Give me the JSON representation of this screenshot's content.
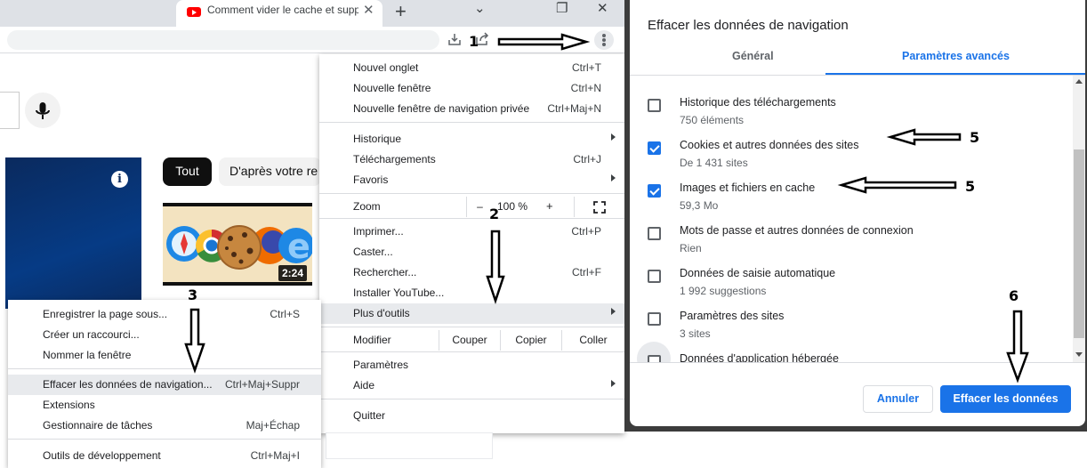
{
  "browser": {
    "tab_title": "Comment vider le cache et supp",
    "tab_close": "✕",
    "new_tab": "+",
    "window_controls": {
      "dropdown": "⌄",
      "restore": "❐",
      "close": "✕"
    }
  },
  "page": {
    "chips": {
      "all": "Tout",
      "recommended": "D'après votre re"
    },
    "info": "i",
    "thumbnail_duration": "2:24"
  },
  "main_menu": {
    "new_tab": {
      "label": "Nouvel onglet",
      "shortcut": "Ctrl+T"
    },
    "new_window": {
      "label": "Nouvelle fenêtre",
      "shortcut": "Ctrl+N"
    },
    "new_private": {
      "label": "Nouvelle fenêtre de navigation privée",
      "shortcut": "Ctrl+Maj+N"
    },
    "history": {
      "label": "Historique"
    },
    "downloads": {
      "label": "Téléchargements",
      "shortcut": "Ctrl+J"
    },
    "bookmarks": {
      "label": "Favoris"
    },
    "zoom": {
      "label": "Zoom",
      "minus": "–",
      "value": "100 %",
      "plus": "+"
    },
    "print": {
      "label": "Imprimer...",
      "shortcut": "Ctrl+P"
    },
    "cast": {
      "label": "Caster..."
    },
    "find": {
      "label": "Rechercher...",
      "shortcut": "Ctrl+F"
    },
    "install": {
      "label": "Installer YouTube..."
    },
    "more_tools": {
      "label": "Plus d'outils"
    },
    "edit": {
      "label": "Modifier",
      "cut": "Couper",
      "copy": "Copier",
      "paste": "Coller"
    },
    "settings": {
      "label": "Paramètres"
    },
    "help": {
      "label": "Aide"
    },
    "quit": {
      "label": "Quitter"
    }
  },
  "sub_menu": {
    "save_page": {
      "label": "Enregistrer la page sous...",
      "shortcut": "Ctrl+S"
    },
    "create_shortcut": {
      "label": "Créer un raccourci..."
    },
    "name_window": {
      "label": "Nommer la fenêtre"
    },
    "clear_data": {
      "label": "Effacer les données de navigation...",
      "shortcut": "Ctrl+Maj+Suppr"
    },
    "extensions": {
      "label": "Extensions"
    },
    "task_manager": {
      "label": "Gestionnaire de tâches",
      "shortcut": "Maj+Échap"
    },
    "dev_tools": {
      "label": "Outils de développement",
      "shortcut": "Ctrl+Maj+I"
    }
  },
  "dialog": {
    "title": "Effacer les données de navigation",
    "tabs": {
      "basic": "Général",
      "advanced": "Paramètres avancés"
    },
    "options": [
      {
        "title": "Historique des téléchargements",
        "subtitle": "750 éléments",
        "checked": false
      },
      {
        "title": "Cookies et autres données des sites",
        "subtitle": "De 1 431 sites",
        "checked": true
      },
      {
        "title": "Images et fichiers en cache",
        "subtitle": "59,3 Mo",
        "checked": true
      },
      {
        "title": "Mots de passe et autres données de connexion",
        "subtitle": "Rien",
        "checked": false
      },
      {
        "title": "Données de saisie automatique",
        "subtitle": "1 992 suggestions",
        "checked": false
      },
      {
        "title": "Paramètres des sites",
        "subtitle": "3 sites",
        "checked": false
      },
      {
        "title": "Données d'application hébergée",
        "subtitle": "",
        "checked": false
      }
    ],
    "cancel": "Annuler",
    "confirm": "Effacer les données"
  },
  "annotations": {
    "step1": "1",
    "step2": "2",
    "step3": "3",
    "step5a": "5",
    "step5b": "5",
    "step6": "6"
  },
  "colors": {
    "accent": "#1a73e8",
    "menu_highlight": "#e8eaed",
    "youtube_red": "#ff0000"
  }
}
